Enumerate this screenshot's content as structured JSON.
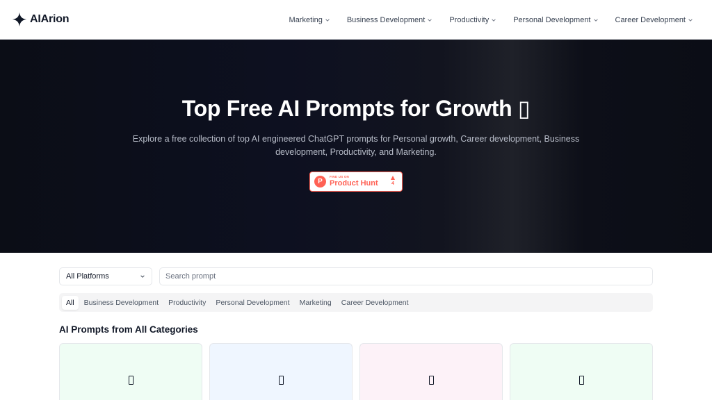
{
  "brand": {
    "name": "AIArion",
    "icon": "sparkle-icon"
  },
  "nav": [
    {
      "label": "Marketing"
    },
    {
      "label": "Business Development"
    },
    {
      "label": "Productivity"
    },
    {
      "label": "Personal Development"
    },
    {
      "label": "Career Development"
    }
  ],
  "hero": {
    "title": "Top Free AI Prompts for Growth ▯",
    "description": "Explore a free collection of top AI engineered ChatGPT prompts for Personal growth, Career development, Business development, Productivity, and Marketing.",
    "badge": {
      "small_text": "FIND US ON",
      "big_text": "Product Hunt",
      "logo_letter": "P",
      "count": "4"
    }
  },
  "filters": {
    "platform": "All Platforms",
    "search_placeholder": "Search prompt",
    "tabs": [
      {
        "label": "All",
        "active": true
      },
      {
        "label": "Business Development"
      },
      {
        "label": "Productivity"
      },
      {
        "label": "Personal Development"
      },
      {
        "label": "Marketing"
      },
      {
        "label": "Career Development"
      }
    ]
  },
  "section": {
    "title": "AI Prompts from All Categories"
  },
  "cards": [
    {
      "color": "#effdf4"
    },
    {
      "color": "#eff6ff"
    },
    {
      "color": "#fdf2f8"
    },
    {
      "color": "#effdf4"
    }
  ]
}
